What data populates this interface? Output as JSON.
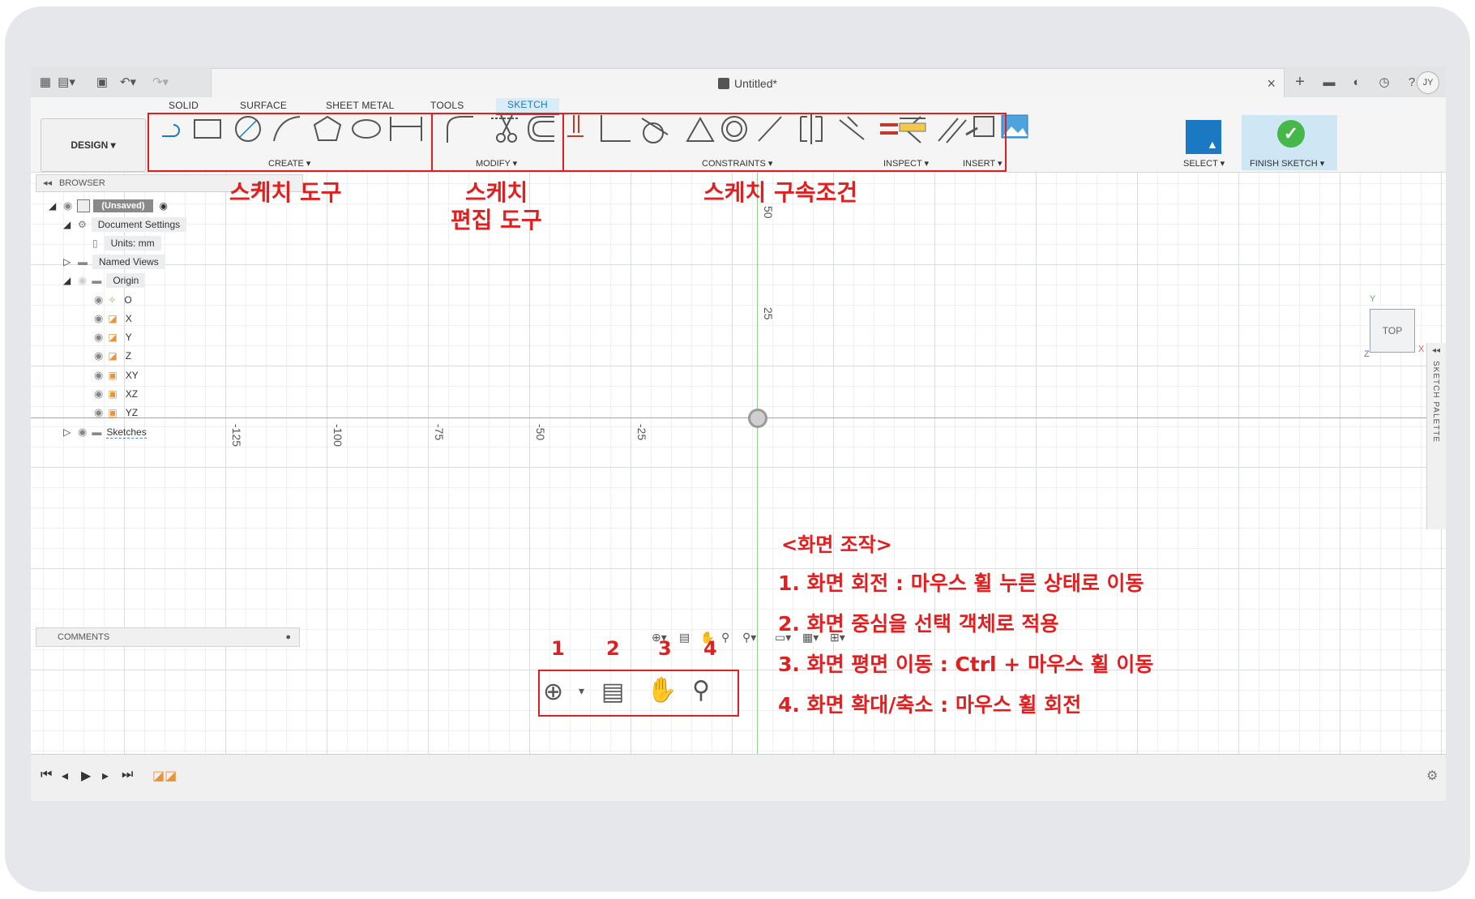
{
  "titlebar": {
    "title": "Untitled*",
    "avatar": "JY",
    "close": "×"
  },
  "ribbon": {
    "tabs": [
      "SOLID",
      "SURFACE",
      "SHEET METAL",
      "TOOLS",
      "SKETCH"
    ],
    "design_label": "DESIGN ▾",
    "groups": {
      "create": "CREATE ▾",
      "modify": "MODIFY ▾",
      "constraints": "CONSTRAINTS ▾",
      "inspect": "INSPECT ▾",
      "insert": "INSERT ▾",
      "select": "SELECT ▾",
      "finish": "FINISH SKETCH ▾"
    }
  },
  "browser": {
    "title": "BROWSER",
    "root": "(Unsaved)",
    "document_settings": "Document Settings",
    "units": "Units: mm",
    "named_views": "Named Views",
    "origin": "Origin",
    "origin_items": [
      "O",
      "X",
      "Y",
      "Z",
      "XY",
      "XZ",
      "YZ"
    ],
    "sketches": "Sketches"
  },
  "canvas": {
    "h_ticks": [
      "-125",
      "-100",
      "-75",
      "-50",
      "-25"
    ],
    "v_ticks": [
      "50",
      "25"
    ],
    "viewcube": "TOP",
    "axis_labels": {
      "y": "Y",
      "x": "X",
      "z": "Z"
    },
    "palette": "SKETCH PALETTE"
  },
  "comments": "COMMENTS",
  "annotations": {
    "sketch_tools": "스케치 도구",
    "sketch_edit_line1": "스케치",
    "sketch_edit_line2": "편집 도구",
    "constraints": "스케치 구속조건",
    "nav_title": "<화면 조작>",
    "nav_numbers": [
      "1",
      "2",
      "3",
      "4"
    ],
    "nav_items": [
      "1.  화면 회전 : 마우스 휠 누른 상태로 이동",
      "2.  화면 중심을 선택 객체로 적용",
      "3.  화면 평면 이동 : Ctrl + 마우스 휠 이동",
      "4.  화면 확대/축소 : 마우스 휠 회전"
    ]
  },
  "colors": {
    "accent": "#1b79c3",
    "annotation_red": "#e02020",
    "finish_green": "#46b749"
  }
}
